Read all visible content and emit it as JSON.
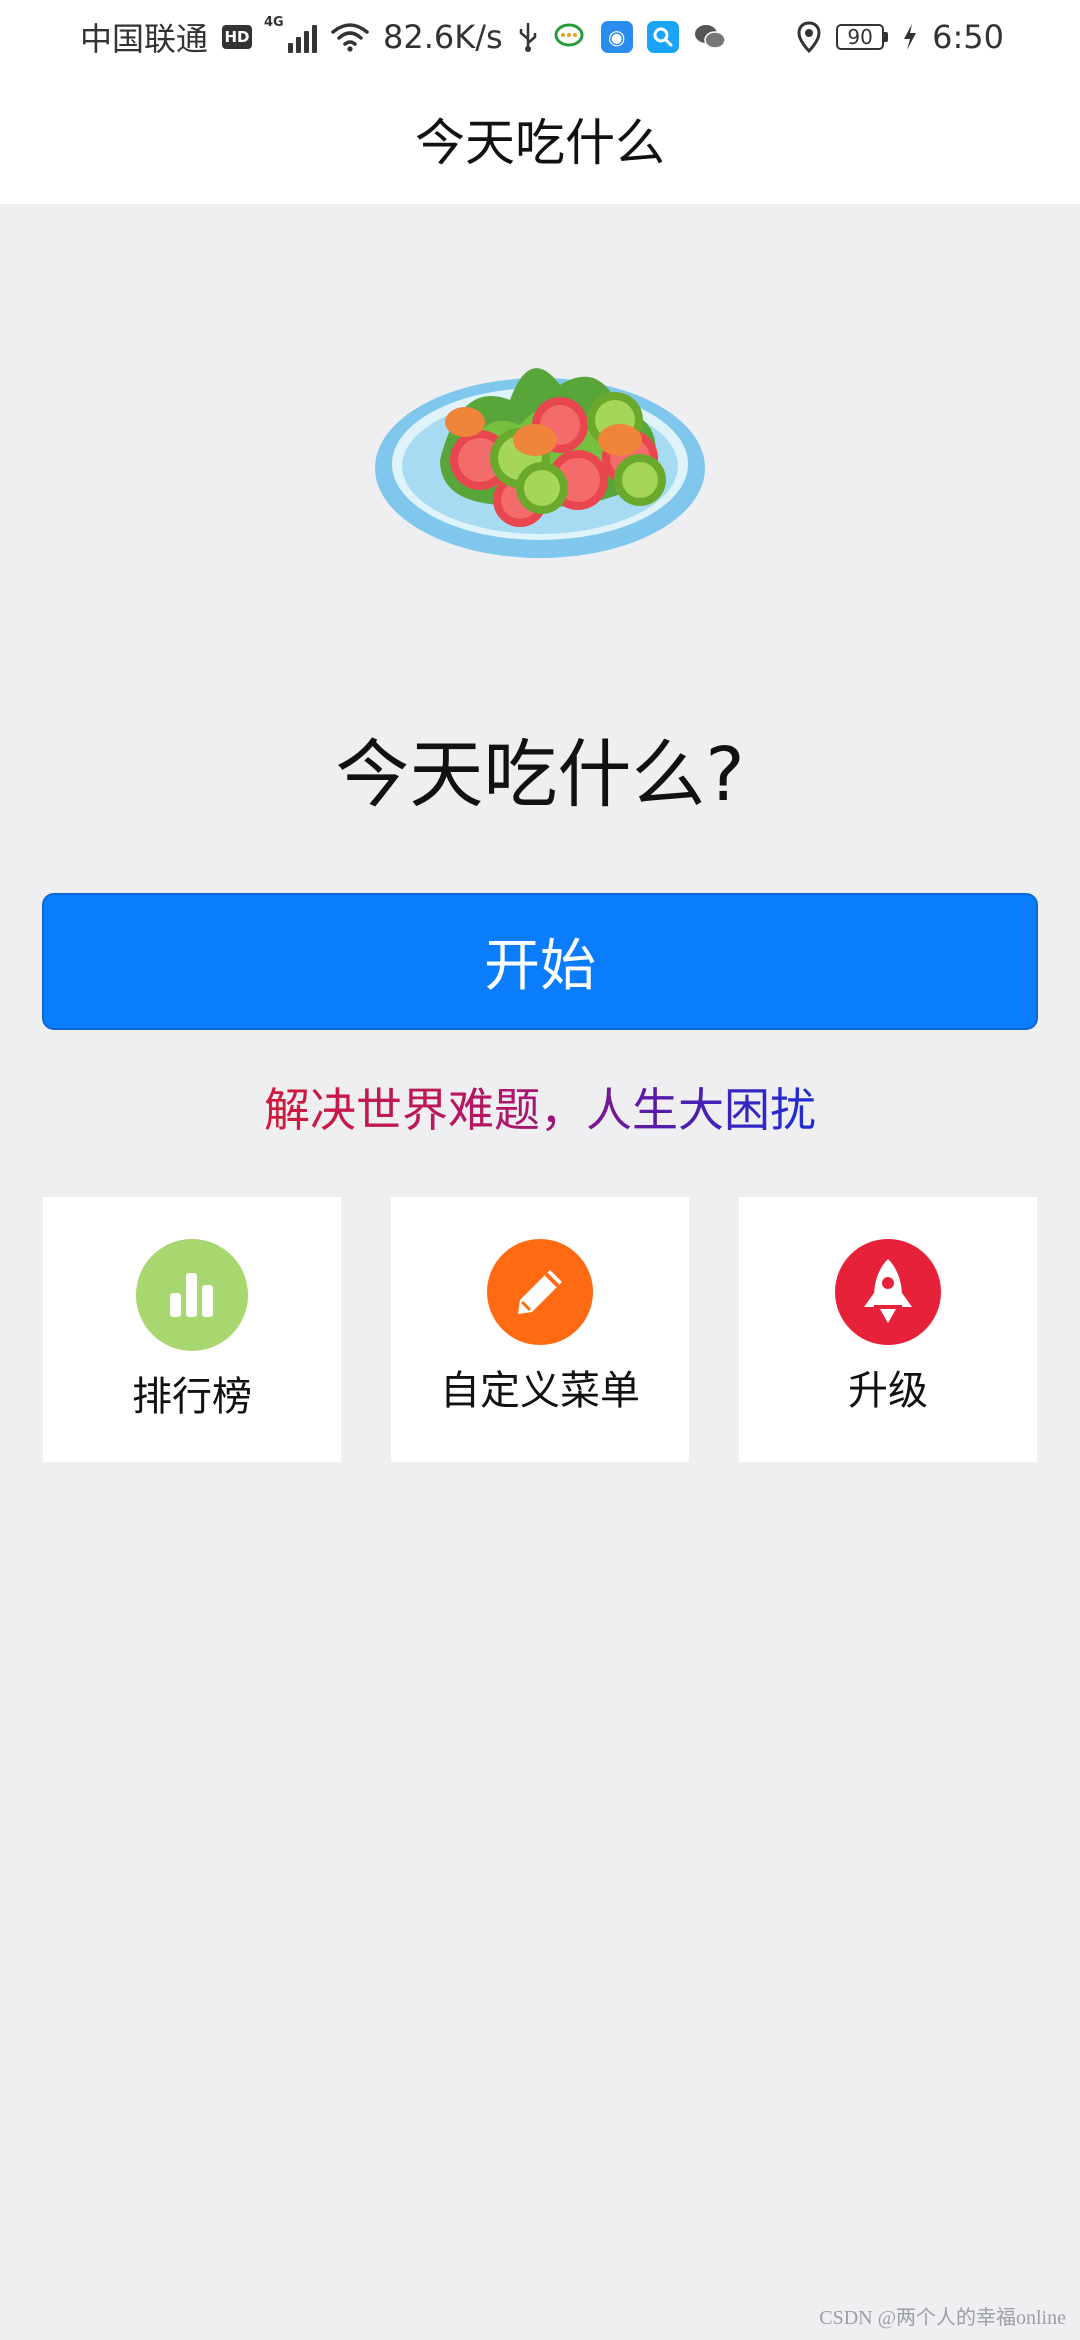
{
  "status_bar": {
    "carrier": "中国联通",
    "hd": "HD",
    "network": "4G",
    "speed": "82.6K/s",
    "battery": "90",
    "time": "6:50"
  },
  "header": {
    "title": "今天吃什么"
  },
  "main": {
    "question": "今天吃什么?",
    "start_label": "开始",
    "slogan": "解决世界难题，人生大困扰",
    "cards": [
      {
        "label": "排行榜",
        "icon": "bar-chart-icon",
        "color": "#a8d66f"
      },
      {
        "label": "自定义菜单",
        "icon": "pencil-icon",
        "color": "#ff6a13"
      },
      {
        "label": "升级",
        "icon": "rocket-icon",
        "color": "#e8213b"
      }
    ]
  },
  "watermark": "CSDN @两个人的幸福online",
  "colors": {
    "primary": "#0a7dff",
    "background": "#efeff1"
  }
}
